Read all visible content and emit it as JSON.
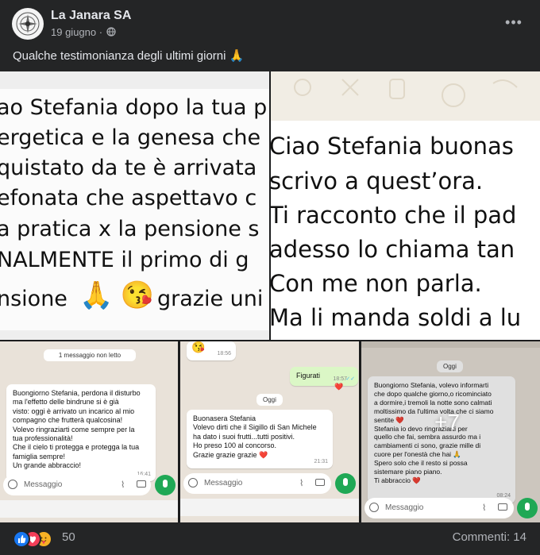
{
  "post": {
    "page_name": "La Janara SA",
    "date": "19 giugno · ",
    "caption": "Qualche testimonianza degli ultimi giorni 🙏"
  },
  "tile1": {
    "lines": [
      "ao Stefania dopo la tua p",
      "ergetica e la genesa che",
      "quistato da te è arrivata",
      "efonata che aspettavo c",
      "a pratica x la pensione s",
      "NALMENTE il primo di g",
      "nsione",
      "grazie uni"
    ],
    "emojis": "🙏 😘"
  },
  "tile2": {
    "lines": [
      "Ciao Stefania buonas",
      "scrivo a quest’ora.",
      "Ti racconto che il pad",
      "adesso lo chiama tan",
      "Con me non parla.",
      "Ma li manda soldi a lu"
    ]
  },
  "tile3": {
    "unread_pill": "1 messaggio non letto",
    "message": [
      "Buongiorno Stefania, perdona il disturbo",
      "ma l'effetto delle bindrune si è già",
      "visto: oggi è arrivato un incarico al mio",
      "compagno che frutterà qualcosina!",
      "Volevo ringraziarti come sempre per la",
      "tua professionalità!",
      "Che il cielo ti protegga e protegga la tua",
      "famiglia sempre!",
      "Un grande abbraccio!"
    ],
    "time": "16:41",
    "input_placeholder": "Messaggio"
  },
  "tile4": {
    "top_time": "18:56",
    "figurati": "Figurati",
    "figurati_time": "18:57",
    "day_pill": "Oggi",
    "message": [
      "Buonasera Stefania",
      "Volevo dirti che il Sigillo di San Michele",
      "ha dato i suoi frutti...tutti positivi.",
      "Ho preso 100 al concorso.",
      "Grazie grazie grazie ❤️"
    ],
    "time": "21:31",
    "input_placeholder": "Messaggio"
  },
  "tile5": {
    "day_pill": "Oggi",
    "message": [
      "Buongiorno Stefania, volevo informarti",
      "che dopo qualche giorno,o ricominciato",
      "a dormire,i tremoli la notte sono calmati",
      "moltissimo da l'ultima volta che ci siamo",
      "sentite ❤️",
      "Stefania io devo ringraziarti per",
      "quello che fai, sembra assurdo ma i",
      "cambiamenti ci sono, grazie mille di",
      "cuore per l'onestà che hai 🙏",
      "Spero solo che il resto si possa",
      "sistemare piano piano.",
      "Ti abbraccio ❤️"
    ],
    "time": "08:24",
    "more_overlay": "+7",
    "input_placeholder": "Messaggio"
  },
  "footer": {
    "reaction_count": "50",
    "comments": "Commenti: 14"
  },
  "colors": {
    "bg": "#242526",
    "wa_green": "#1fa855",
    "like_blue": "#1877f2",
    "love_red": "#f33e58"
  }
}
